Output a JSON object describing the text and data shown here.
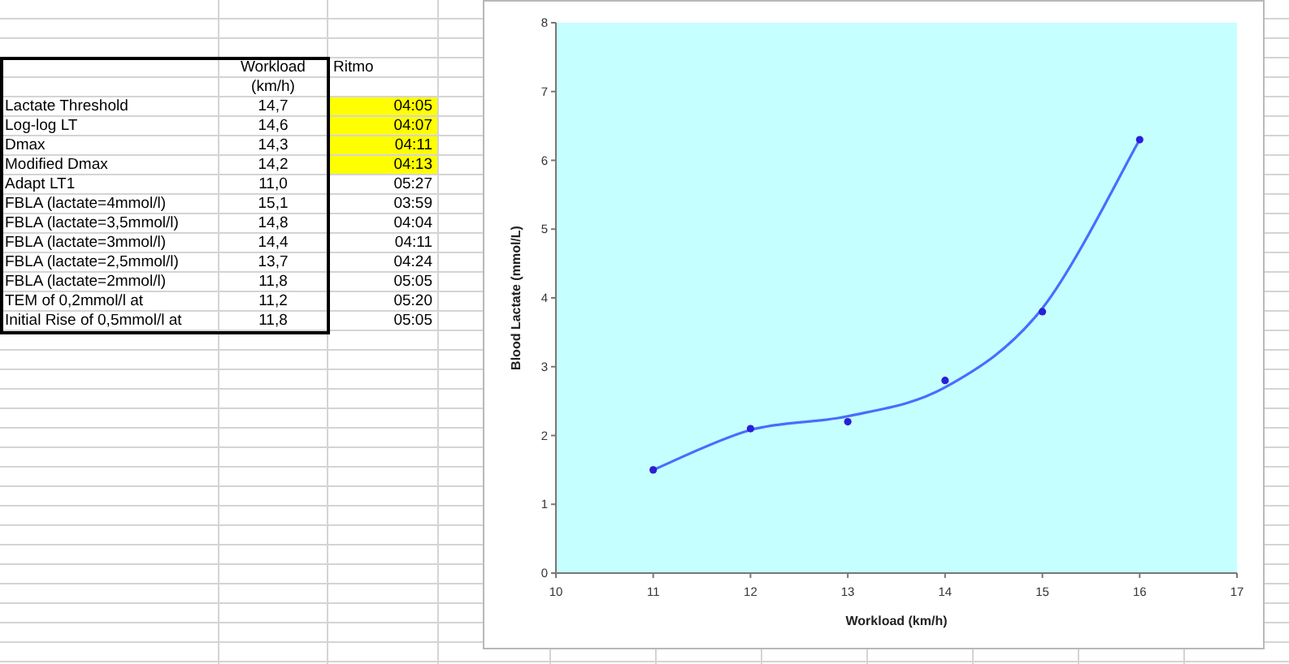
{
  "table": {
    "header": [
      "Workload",
      "Ritmo"
    ],
    "subheader": "(km/h)",
    "rows": [
      {
        "label": "Lactate Threshold",
        "workload": "14,7",
        "ritmo": "04:05",
        "highlighted": true
      },
      {
        "label": "Log-log LT",
        "workload": "14,6",
        "ritmo": "04:07",
        "highlighted": true
      },
      {
        "label": "Dmax",
        "workload": "14,3",
        "ritmo": "04:11",
        "highlighted": true
      },
      {
        "label": "Modified Dmax",
        "workload": "14,2",
        "ritmo": "04:13",
        "highlighted": true
      },
      {
        "label": "Adapt LT1",
        "workload": "11,0",
        "ritmo": "05:27",
        "highlighted": false
      },
      {
        "label": "FBLA (lactate=4mmol/l)",
        "workload": "15,1",
        "ritmo": "03:59",
        "highlighted": false
      },
      {
        "label": "FBLA (lactate=3,5mmol/l)",
        "workload": "14,8",
        "ritmo": "04:04",
        "highlighted": false
      },
      {
        "label": "FBLA (lactate=3mmol/l)",
        "workload": "14,4",
        "ritmo": "04:11",
        "highlighted": false
      },
      {
        "label": "FBLA (lactate=2,5mmol/l)",
        "workload": "13,7",
        "ritmo": "04:24",
        "highlighted": false
      },
      {
        "label": "FBLA (lactate=2mmol/l)",
        "workload": "11,8",
        "ritmo": "05:05",
        "highlighted": false
      },
      {
        "label": "TEM of 0,2mmol/l at",
        "workload": "11,2",
        "ritmo": "05:20",
        "highlighted": false
      },
      {
        "label": "Initial Rise of 0,5mmol/l at",
        "workload": "11,8",
        "ritmo": "05:05",
        "highlighted": false
      }
    ]
  },
  "chart": {
    "chart_data": {
      "type": "scatter",
      "xlabel": "Workload (km/h)",
      "ylabel": "Blood Lactate (mmol/L)",
      "x": [
        11,
        12,
        13,
        14,
        15,
        16
      ],
      "series": [
        {
          "type": "scatter",
          "color": "#2a1fd6",
          "values": [
            1.5,
            2.1,
            2.2,
            2.8,
            3.8,
            6.3
          ]
        },
        {
          "type": "line",
          "color": "#4a6cff",
          "values": [
            1.5,
            2.08,
            2.28,
            2.7,
            3.85,
            6.3
          ]
        }
      ],
      "xlim": [
        10,
        17
      ],
      "ylim": [
        0,
        8
      ],
      "xticks": [
        10,
        11,
        12,
        13,
        14,
        15,
        16,
        17
      ],
      "yticks": [
        0,
        1,
        2,
        3,
        4,
        5,
        6,
        7,
        8
      ]
    }
  }
}
